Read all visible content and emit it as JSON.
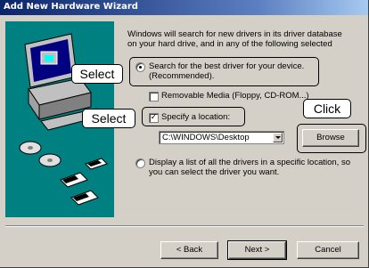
{
  "window": {
    "title": "Add New Hardware Wizard"
  },
  "intro": {
    "line1": "Windows will search for new drivers in its driver database",
    "line2": "on your hard drive, and in any of the following selected"
  },
  "option_search": {
    "line1": "Search for the best driver for your device.",
    "line2": "(Recommended).",
    "selected": true
  },
  "removable_media": {
    "label": "Removable Media (Floppy, CD-ROM...)",
    "checked": false
  },
  "specify_location": {
    "label": "Specify a location:",
    "checked": true
  },
  "location_combo": {
    "value": "C:\\WINDOWS\\Desktop"
  },
  "browse_button": {
    "label": "Browse"
  },
  "option_display": {
    "line1": "Display a list of all the drivers in a specific location, so",
    "line2": "you can select the driver you want.",
    "selected": false
  },
  "buttons": {
    "back": "< Back",
    "next": "Next >",
    "cancel": "Cancel"
  },
  "callouts": {
    "select_1": "Select",
    "select_2": "Select",
    "click": "Click"
  },
  "colors": {
    "title_bar": "#0a246a",
    "dialog_bg": "#d4d0c8",
    "art_bg": "#008080"
  }
}
